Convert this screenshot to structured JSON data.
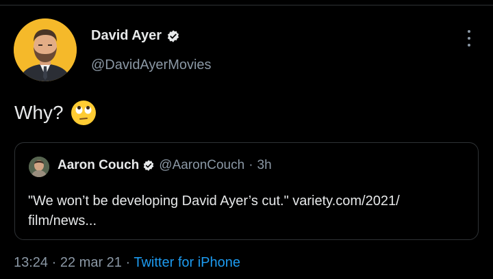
{
  "author": {
    "name": "David Ayer",
    "handle": "@DavidAyerMovies",
    "verified_icon": "verified-badge-icon"
  },
  "tweet": {
    "text": "Why?",
    "emoji": "face-with-rolling-eyes"
  },
  "quoted_tweet": {
    "name": "Aaron Couch",
    "handle": "@AaronCouch",
    "separator": "·",
    "time": "3h",
    "text_line1": "\"We won’t be developing David Ayer’s cut.\" variety.com/2021/",
    "text_line2": "film/news..."
  },
  "meta": {
    "time": "13:24",
    "separator1": "·",
    "date": "22 mar 21",
    "separator2": "·",
    "source": "Twitter for iPhone"
  },
  "colors": {
    "background": "#000000",
    "text": "#e7e9ea",
    "muted": "#8b98a5",
    "link": "#1d9bf0",
    "avatar_bg": "#f5b92a"
  }
}
